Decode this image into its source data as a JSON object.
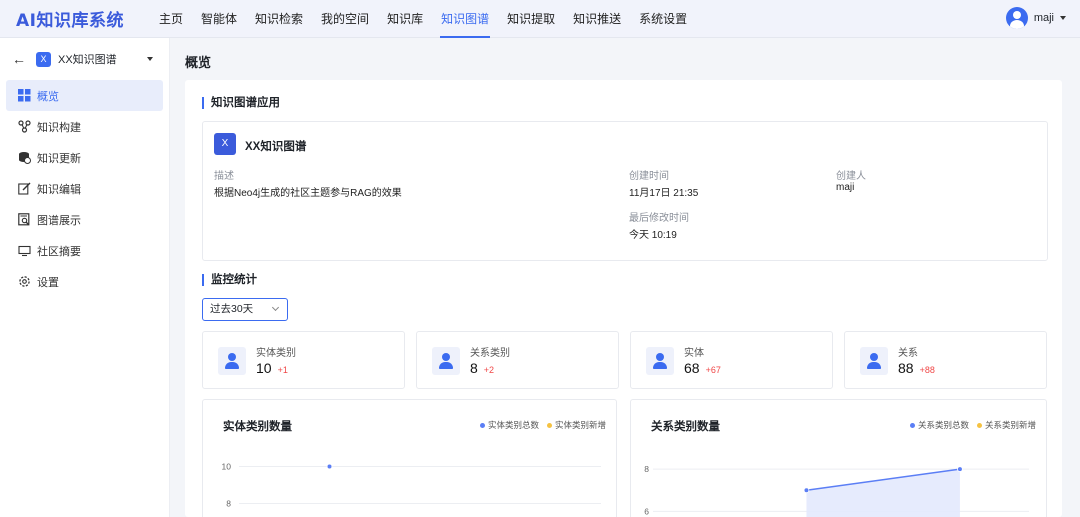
{
  "app": {
    "logo": "AI知识库系统"
  },
  "nav": {
    "items": [
      "主页",
      "智能体",
      "知识检索",
      "我的空间",
      "知识库",
      "知识图谱",
      "知识提取",
      "知识推送",
      "系统设置"
    ],
    "active_index": 5
  },
  "user": {
    "name": "maji"
  },
  "sidebar": {
    "kb_icon": "X",
    "kb_name": "XX知识图谱",
    "items": [
      {
        "label": "概览",
        "icon": "grid-icon",
        "active": true
      },
      {
        "label": "知识构建",
        "icon": "graph-nodes-icon"
      },
      {
        "label": "知识更新",
        "icon": "database-sync-icon"
      },
      {
        "label": "知识编辑",
        "icon": "edit-icon"
      },
      {
        "label": "图谱展示",
        "icon": "search-doc-icon"
      },
      {
        "label": "社区摘要",
        "icon": "monitor-icon"
      },
      {
        "label": "设置",
        "icon": "gear-icon"
      }
    ]
  },
  "page": {
    "title": "概览"
  },
  "app_section": {
    "title": "知识图谱应用",
    "badge": "X",
    "name": "XX知识图谱",
    "description_label": "描述",
    "description": "根据Neo4j生成的社区主题参与RAG的效果",
    "created_label": "创建时间",
    "created_value": "11月17日 21:35",
    "creator_label": "创建人",
    "creator_value": "maji",
    "modified_label": "最后修改时间",
    "modified_value": "今天 10:19"
  },
  "monitor": {
    "title": "监控统计",
    "range": "过去30天",
    "stats": [
      {
        "label": "实体类别",
        "value": "10",
        "delta": "+1"
      },
      {
        "label": "关系类别",
        "value": "8",
        "delta": "+2"
      },
      {
        "label": "实体",
        "value": "68",
        "delta": "+67"
      },
      {
        "label": "关系",
        "value": "88",
        "delta": "+88"
      }
    ]
  },
  "colors": {
    "accent": "#3b6bf0",
    "series_total": "#5b7ef5",
    "series_new": "#f5c242",
    "delta": "#f04848"
  },
  "chart_data": [
    {
      "type": "line",
      "title": "实体类别数量",
      "series": [
        {
          "name": "实体类别总数",
          "points": [
            [
              1,
              10
            ]
          ]
        },
        {
          "name": "实体类别新增",
          "points": []
        }
      ],
      "x_range": [
        0,
        4
      ],
      "y_ticks": [
        10,
        8
      ],
      "ylim": [
        7,
        11
      ],
      "legend": "top-right",
      "grid": true
    },
    {
      "type": "area",
      "title": "关系类别数量",
      "series": [
        {
          "name": "关系类别总数",
          "points": [
            [
              1,
              7
            ],
            [
              2,
              8
            ]
          ]
        },
        {
          "name": "关系类别新增",
          "points": []
        }
      ],
      "x_range": [
        0,
        2.45
      ],
      "y_ticks": [
        8,
        6
      ],
      "ylim": [
        5.5,
        9
      ],
      "legend": "top-right",
      "grid": true
    }
  ]
}
